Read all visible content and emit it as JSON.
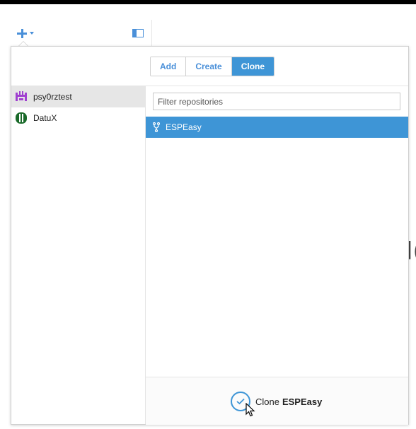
{
  "toolbar": {
    "add_menu_icon": "plus-icon",
    "sidebar_toggle_icon": "sidebar-toggle-icon"
  },
  "background": {
    "partial_text": "l("
  },
  "popover": {
    "tabs": [
      {
        "label": "Add",
        "active": false
      },
      {
        "label": "Create",
        "active": false
      },
      {
        "label": "Clone",
        "active": true
      }
    ],
    "accounts": [
      {
        "name": "psy0rztest",
        "selected": true,
        "avatar_color": "#a040d0"
      },
      {
        "name": "DatuX",
        "selected": false,
        "avatar_color": "#1a6a2a"
      }
    ],
    "filter": {
      "placeholder": "Filter repositories",
      "value": ""
    },
    "repositories": [
      {
        "name": "ESPEasy",
        "icon": "fork-icon",
        "selected": true
      }
    ],
    "clone_button": {
      "prefix": "Clone",
      "repo": "ESPEasy",
      "icon": "check-circle-icon"
    }
  },
  "colors": {
    "accent": "#3e95d6",
    "selection_gray": "#e6e6e6"
  }
}
